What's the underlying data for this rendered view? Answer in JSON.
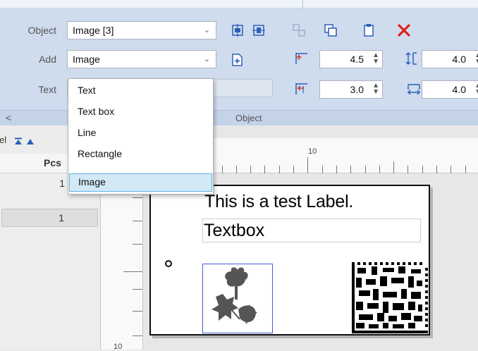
{
  "ribbon": {
    "object_label": "Object",
    "object_value": "Image [3]",
    "add_label": "Add",
    "add_value": "Image",
    "text_label": "Text",
    "pos_x": "4.5",
    "pos_y": "3.0",
    "width": "4.0",
    "height": "4.0",
    "group_scroll_left": "<",
    "group_name": "Object"
  },
  "dropdown": {
    "items": [
      "Text",
      "Text box",
      "Line",
      "Rectangle",
      "Image"
    ],
    "highlighted": "Image"
  },
  "left_panel": {
    "toolbar_fragment": "el",
    "column_header": "Pcs",
    "rows": [
      "1",
      "1"
    ]
  },
  "ruler": {
    "top_number": "10",
    "left_number": "10"
  },
  "label": {
    "text": "This is a test Label.",
    "textbox": "Textbox"
  },
  "colors": {
    "ribbon_bg": "#cfdcee",
    "delete_red": "#e0201b",
    "selection_blue": "#4a5ad8",
    "dropdown_highlight": "#d2e9f6"
  }
}
